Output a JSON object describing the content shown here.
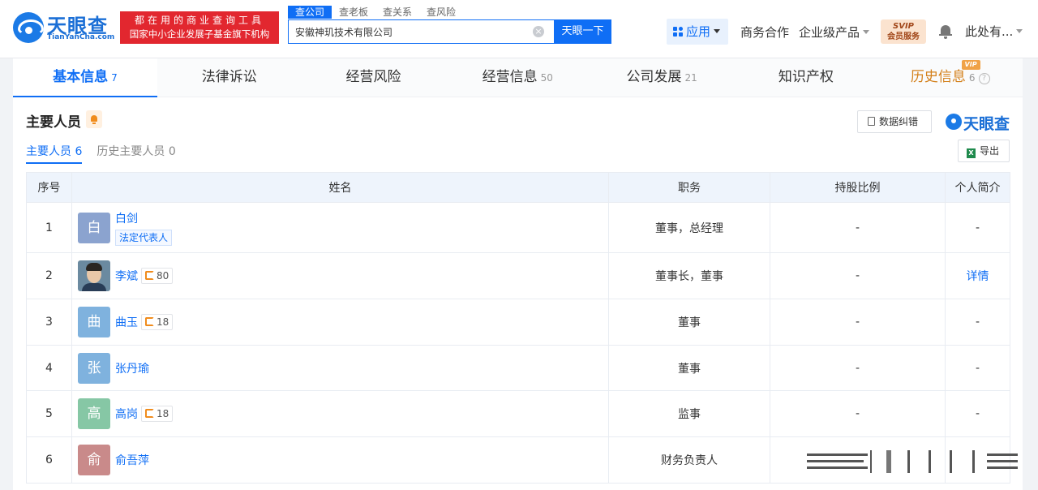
{
  "header": {
    "logo_text": "天眼查",
    "logo_sub": "TianYanCha.com",
    "slogan_line1": "都在用的商业查询工具",
    "slogan_line2": "国家中小企业发展子基金旗下机构",
    "search_tabs": [
      "查公司",
      "查老板",
      "查关系",
      "查风险"
    ],
    "search_value": "安徽神玑技术有限公司",
    "clear_icon": "clear-icon",
    "search_button": "天眼一下",
    "apps_label": "应用",
    "business_label": "商务合作",
    "enterprise_label": "企业级产品",
    "svip_line1": "SVIP",
    "svip_line2": "会员服务",
    "user_label": "此处有..."
  },
  "tabs": [
    {
      "label": "基本信息",
      "count": "7"
    },
    {
      "label": "法律诉讼",
      "count": ""
    },
    {
      "label": "经营风险",
      "count": ""
    },
    {
      "label": "经营信息",
      "count": "50"
    },
    {
      "label": "公司发展",
      "count": "21"
    },
    {
      "label": "知识产权",
      "count": ""
    },
    {
      "label": "历史信息",
      "count": "6",
      "badge": "VIP",
      "help": "?"
    }
  ],
  "section": {
    "title": "主要人员",
    "correct_button": "数据纠错",
    "brand": "天眼查",
    "export_button": "导出",
    "excel_icon": "X",
    "subtabs": [
      {
        "label": "主要人员",
        "count": "6"
      },
      {
        "label": "历史主要人员",
        "count": "0"
      }
    ]
  },
  "table": {
    "headers": [
      "序号",
      "姓名",
      "职务",
      "持股比例",
      "个人简介"
    ],
    "rows": [
      {
        "no": "1",
        "avatar": "白",
        "name": "白剑",
        "tag": "法定代表人",
        "rel": "",
        "title": "董事，总经理",
        "share": "-",
        "intro": "-"
      },
      {
        "no": "2",
        "avatar": "",
        "name": "李斌",
        "tag": "",
        "rel": "80",
        "title": "董事长，董事",
        "share": "-",
        "intro": "详情"
      },
      {
        "no": "3",
        "avatar": "曲",
        "name": "曲玉",
        "tag": "",
        "rel": "18",
        "title": "董事",
        "share": "-",
        "intro": "-"
      },
      {
        "no": "4",
        "avatar": "张",
        "name": "张丹瑜",
        "tag": "",
        "rel": "",
        "title": "董事",
        "share": "-",
        "intro": "-"
      },
      {
        "no": "5",
        "avatar": "高",
        "name": "高岗",
        "tag": "",
        "rel": "18",
        "title": "监事",
        "share": "-",
        "intro": "-"
      },
      {
        "no": "6",
        "avatar": "俞",
        "name": "俞吾萍",
        "tag": "",
        "rel": "",
        "title": "财务负责人",
        "share": "",
        "intro": ""
      }
    ]
  },
  "colors": {
    "accent": "#0f6ef5",
    "slogan_red": "#e2272f",
    "history_orange": "#d4811c",
    "avatar_bai": "#8ba3cf",
    "avatar_qu": "#7fb2de",
    "avatar_zhang": "#7fb2de",
    "avatar_gao": "#86c7a5",
    "avatar_yu": "#c98a8a"
  }
}
